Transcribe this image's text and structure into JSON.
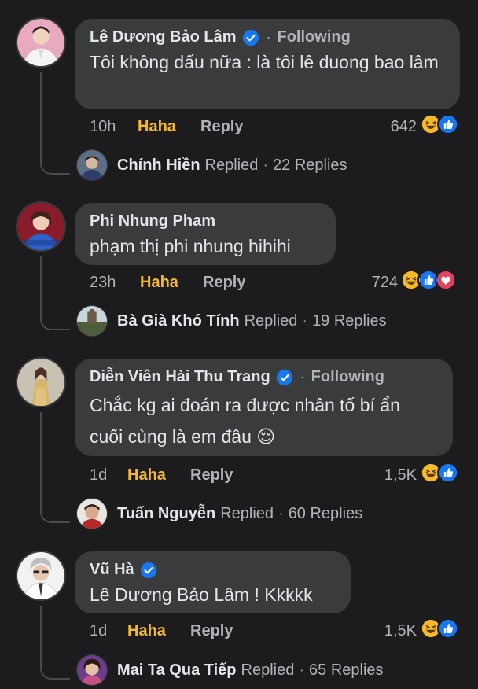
{
  "comments": [
    {
      "author": "Lê Dương Bảo Lâm",
      "verified": true,
      "following": "Following",
      "text": "Tôi không dấu nữa : là tôi lê duong bao lâm",
      "time": "10h",
      "haha": "Haha",
      "reply": "Reply",
      "reaction_count": "642",
      "reactions": [
        "haha-icon",
        "like-icon"
      ],
      "reply_preview": {
        "name": "Chính Hiền",
        "replied": "Replied",
        "separator": "·",
        "count": "22 Replies"
      }
    },
    {
      "author": "Phi Nhung Pham",
      "verified": false,
      "following": "",
      "text": "phạm thị phi nhung hihihi",
      "time": "23h",
      "haha": "Haha",
      "reply": "Reply",
      "reaction_count": "724",
      "reactions": [
        "haha-icon",
        "like-icon",
        "love-icon"
      ],
      "reply_preview": {
        "name": "Bà Già Khó Tính",
        "replied": "Replied",
        "separator": "·",
        "count": "19 Replies"
      }
    },
    {
      "author": "Diễn Viên Hài Thu Trang",
      "verified": true,
      "following": "Following",
      "text": "Chắc kg ai đoán ra được nhân tố bí ẩn cuối cùng là em đâu 😌",
      "time": "1d",
      "haha": "Haha",
      "reply": "Reply",
      "reaction_count": "1,5K",
      "reactions": [
        "haha-icon",
        "like-icon"
      ],
      "reply_preview": {
        "name": "Tuấn Nguyễn",
        "replied": "Replied",
        "separator": "·",
        "count": "60 Replies"
      }
    },
    {
      "author": "Vũ Hà",
      "verified": true,
      "following": "",
      "text": "Lê Dương Bảo Lâm ! Kkkkk",
      "time": "1d",
      "haha": "Haha",
      "reply": "Reply",
      "reaction_count": "1,5K",
      "reactions": [
        "haha-icon",
        "like-icon"
      ],
      "reply_preview": {
        "name": "Mai Ta Qua Tiếp",
        "replied": "Replied",
        "separator": "·",
        "count": "65 Replies"
      }
    }
  ],
  "colors": {
    "background": "#1c1c1e",
    "bubble": "#3a3b3c",
    "haha_text": "#f7b928",
    "verified": "#1877f2",
    "muted_text": "#b0b3b8"
  }
}
